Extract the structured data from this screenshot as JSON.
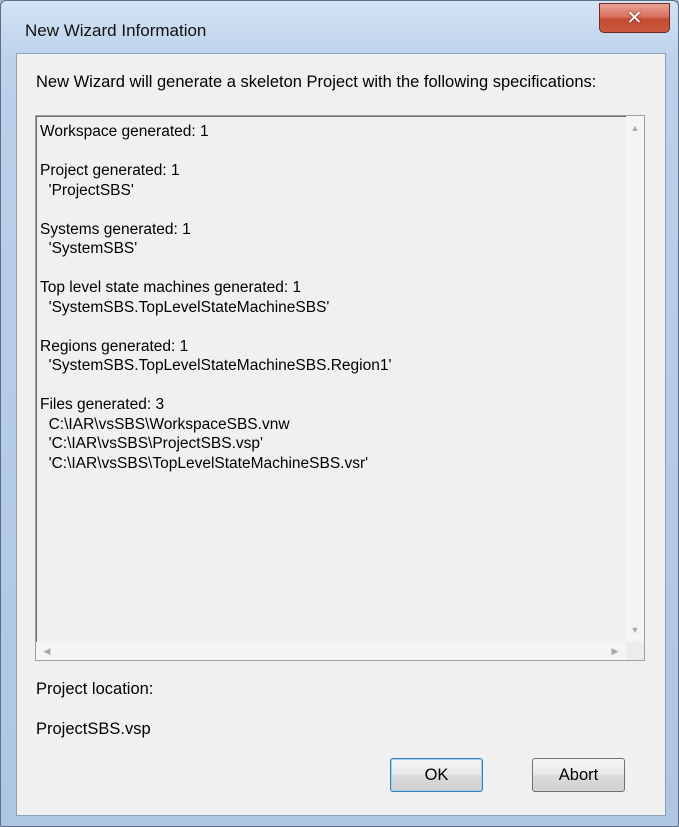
{
  "window": {
    "title": "New Wizard Information",
    "close_glyph": "✕"
  },
  "intro_text": "New Wizard will generate a skeleton Project with the following specifications:",
  "spec_lines": [
    "Workspace generated: 1",
    "",
    "Project generated: 1",
    "  'ProjectSBS'",
    "",
    "Systems generated: 1",
    "  'SystemSBS'",
    "",
    "Top level state machines generated: 1",
    "  'SystemSBS.TopLevelStateMachineSBS'",
    "",
    "Regions generated: 1",
    "  'SystemSBS.TopLevelStateMachineSBS.Region1'",
    "",
    "Files generated: 3",
    "  C:\\IAR\\vsSBS\\WorkspaceSBS.vnw",
    "  'C:\\IAR\\vsSBS\\ProjectSBS.vsp'",
    "  'C:\\IAR\\vsSBS\\TopLevelStateMachineSBS.vsr'"
  ],
  "project_location_label": "Project location:",
  "project_location_value": "ProjectSBS.vsp",
  "buttons": {
    "ok_label": "OK",
    "abort_label": "Abort"
  },
  "icons": {
    "scroll_up": "▲",
    "scroll_down": "▼",
    "scroll_left": "◀",
    "scroll_right": "▶"
  }
}
